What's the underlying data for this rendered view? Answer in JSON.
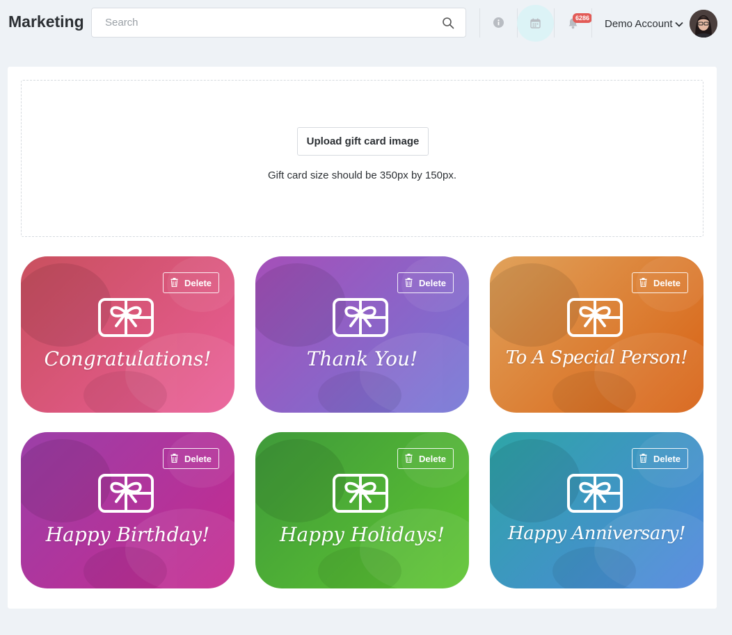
{
  "header": {
    "title": "Marketing",
    "search_placeholder": "Search",
    "notification_count": "6286",
    "account_name": "Demo Account"
  },
  "upload": {
    "button_label": "Upload gift card image",
    "hint": "Gift card size should be 350px by 150px."
  },
  "cards": [
    {
      "title": "Congratulations!",
      "delete_label": "Delete",
      "color_from": "#c9505e",
      "color_to": "#ea5d98"
    },
    {
      "title": "Thank You!",
      "delete_label": "Delete",
      "color_from": "#a54fb8",
      "color_to": "#7477d6"
    },
    {
      "title": "To A Special Person!",
      "delete_label": "Delete",
      "color_from": "#e0a25b",
      "color_to": "#d86012"
    },
    {
      "title": "Happy Birthday!",
      "delete_label": "Delete",
      "color_from": "#9b3fa8",
      "color_to": "#c62a8f"
    },
    {
      "title": "Happy Holidays!",
      "delete_label": "Delete",
      "color_from": "#3f9a3a",
      "color_to": "#5ec531"
    },
    {
      "title": "Happy Anniversary!",
      "delete_label": "Delete",
      "color_from": "#2ea5a7",
      "color_to": "#4f86de"
    }
  ],
  "icons": {
    "search": "search-icon",
    "info": "info-icon",
    "calendar": "calendar-icon",
    "bell": "bell-icon",
    "chevron": "chevron-down-icon",
    "gift_card": "gift-card-icon",
    "trash": "trash-icon"
  }
}
